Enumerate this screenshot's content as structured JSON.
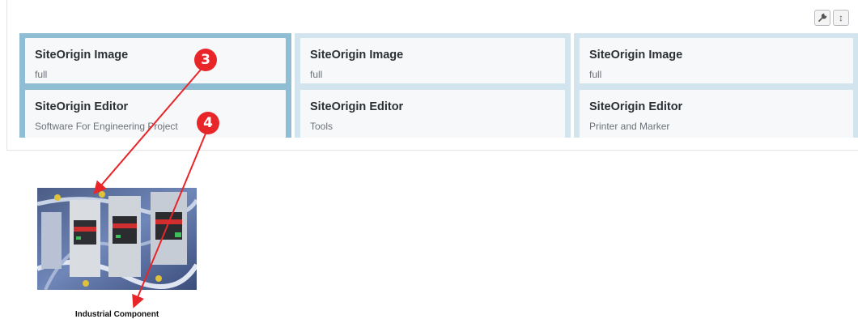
{
  "toolbar": {
    "settings_icon": "wrench-icon",
    "resize_icon": "vertical-resize-icon",
    "resize_glyph": "↕"
  },
  "columns": [
    {
      "widgets": [
        {
          "title": "SiteOrigin Image",
          "description": "full"
        },
        {
          "title": "SiteOrigin Editor",
          "description": "Software For Engineering Project"
        }
      ]
    },
    {
      "widgets": [
        {
          "title": "SiteOrigin Image",
          "description": "full"
        },
        {
          "title": "SiteOrigin Editor",
          "description": "Tools"
        }
      ]
    },
    {
      "widgets": [
        {
          "title": "SiteOrigin Image",
          "description": "full"
        },
        {
          "title": "SiteOrigin Editor",
          "description": "Printer and Marker"
        }
      ]
    }
  ],
  "annotations": {
    "marker_3": "3",
    "marker_4": "4",
    "color": "#e8262a"
  },
  "preview": {
    "caption": "Industrial Component"
  }
}
